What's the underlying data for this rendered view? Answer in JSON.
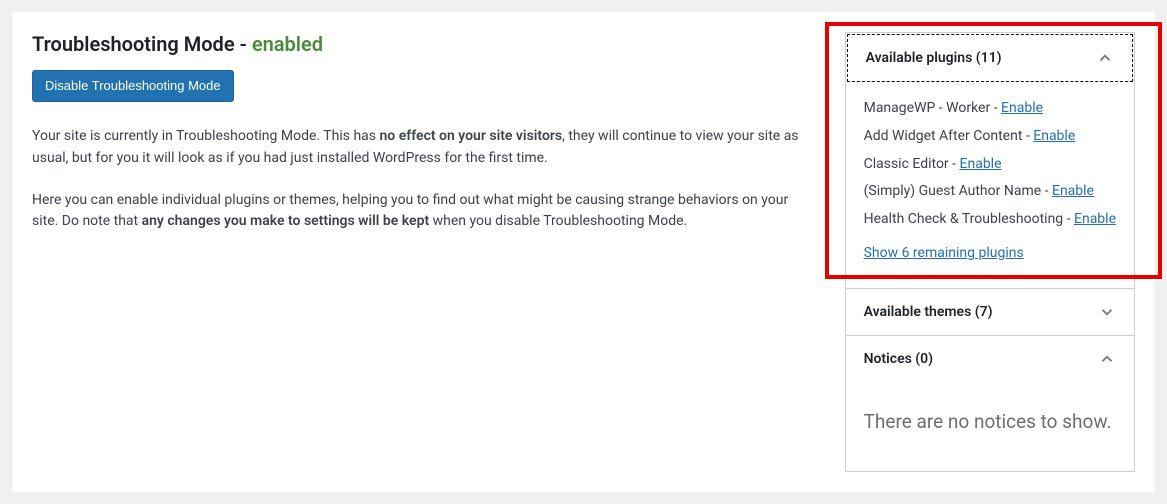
{
  "heading": {
    "prefix": "Troubleshooting Mode - ",
    "status": "enabled"
  },
  "disable_button": "Disable Troubleshooting Mode",
  "description": {
    "p1_a": "Your site is currently in Troubleshooting Mode. This has ",
    "p1_b": "no effect on your site visitors",
    "p1_c": ", they will continue to view your site as usual, but for you it will look as if you had just installed WordPress for the first time.",
    "p2_a": "Here you can enable individual plugins or themes, helping you to find out what might be causing strange behaviors on your site. Do note that ",
    "p2_b": "any changes you make to settings will be kept",
    "p2_c": " when you disable Troubleshooting Mode."
  },
  "plugins": {
    "title": "Available plugins (11)",
    "items": [
      {
        "name": "ManageWP - Worker",
        "action": "Enable"
      },
      {
        "name": "Add Widget After Content",
        "action": "Enable"
      },
      {
        "name": "Classic Editor",
        "action": "Enable"
      },
      {
        "name": "(Simply) Guest Author Name",
        "action": "Enable"
      },
      {
        "name": "Health Check & Troubleshooting",
        "action": "Enable"
      }
    ],
    "show_remaining": "Show 6 remaining plugins"
  },
  "themes": {
    "title": "Available themes (7)"
  },
  "notices": {
    "title": "Notices (0)",
    "empty_text": "There are no notices to show."
  },
  "separator": " - "
}
